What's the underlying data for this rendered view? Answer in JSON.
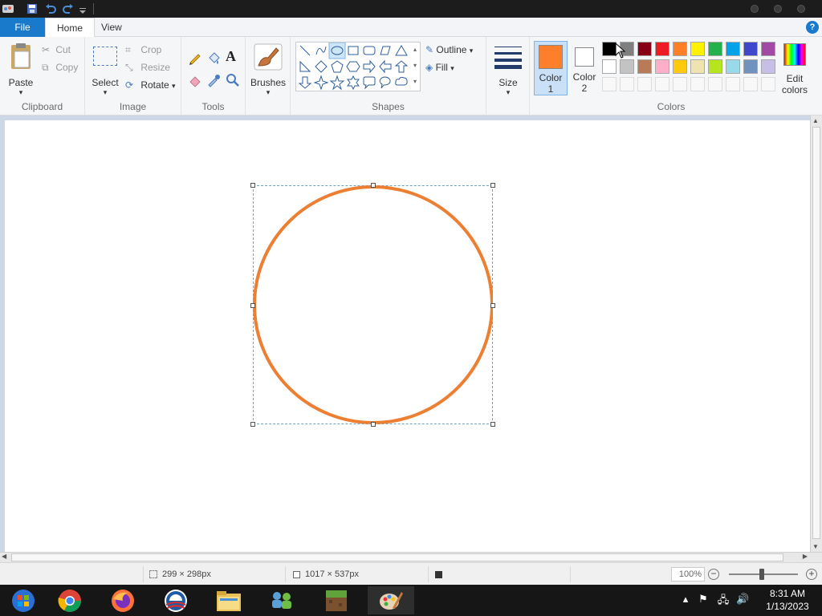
{
  "titlebar": {
    "quick_access": [
      "paint-app-icon",
      "save-icon",
      "undo-icon",
      "redo-icon",
      "customize-dropdown-icon"
    ]
  },
  "tabs": {
    "file": "File",
    "home": "Home",
    "view": "View",
    "help": "?"
  },
  "ribbon": {
    "clipboard": {
      "label": "Clipboard",
      "paste": "Paste",
      "cut": "Cut",
      "copy": "Copy"
    },
    "image": {
      "label": "Image",
      "select": "Select",
      "crop": "Crop",
      "resize": "Resize",
      "rotate": "Rotate"
    },
    "tools": {
      "label": "Tools",
      "items": [
        "pencil-icon",
        "fill-icon",
        "text-icon",
        "eraser-icon",
        "color-picker-icon",
        "magnifier-icon"
      ],
      "text_glyph": "A"
    },
    "brushes": {
      "label": "Brushes"
    },
    "shapes": {
      "label": "Shapes",
      "outline": "Outline",
      "fill": "Fill",
      "selected_shape": "oval"
    },
    "size": {
      "label": "Size"
    },
    "colors": {
      "label": "Colors",
      "color1_label": "Color",
      "color1_num": "1",
      "color2_label": "Color",
      "color2_num": "2",
      "color1_value": "#fd7f2c",
      "color2_value": "#ffffff",
      "edit_label": "Edit",
      "edit_label2": "colors",
      "row1": [
        "#000000",
        "#7f7f7f",
        "#880015",
        "#ed1c24",
        "#ff7f27",
        "#fff200",
        "#22b14c",
        "#00a2e8",
        "#3f48cc",
        "#a349a4"
      ],
      "row2": [
        "#ffffff",
        "#c3c3c3",
        "#b97a57",
        "#ffaec9",
        "#ffc90e",
        "#efe4b0",
        "#b5e61d",
        "#99d9ea",
        "#7092be",
        "#c8bfe7"
      ]
    }
  },
  "canvas": {
    "shape": "circle",
    "stroke_color": "#ed7f33"
  },
  "statusbar": {
    "selection_size": "299 × 298px",
    "image_size": "1017 × 537px",
    "zoom": "100%"
  },
  "taskbar": {
    "apps": [
      "windows-start-icon",
      "chrome-icon",
      "firefox-icon",
      "obama-logo-icon",
      "file-explorer-icon",
      "network-people-icon",
      "minecraft-icon",
      "paint-icon"
    ],
    "time": "8:31 AM",
    "date": "1/13/2023"
  }
}
